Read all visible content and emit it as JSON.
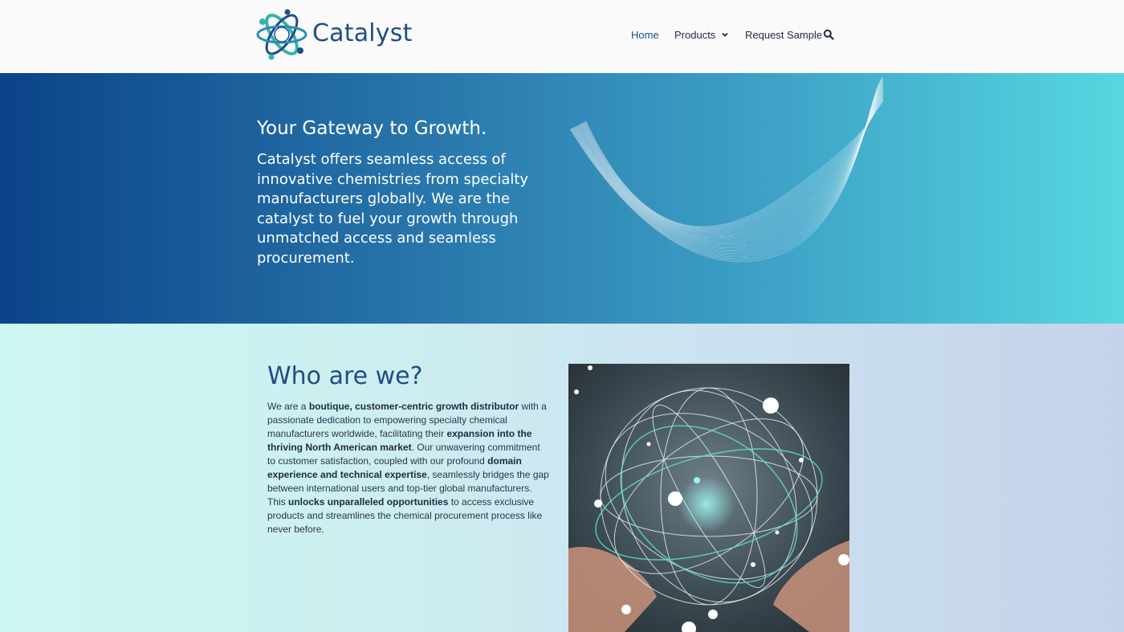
{
  "header": {
    "brand": "Catalyst",
    "nav": {
      "home": "Home",
      "products": "Products",
      "request": "Request Sample"
    }
  },
  "hero": {
    "title": "Your Gateway to Growth.",
    "text": "Catalyst offers seamless access of innovative chemistries from specialty manufacturers globally.  We are the catalyst to fuel your growth through unmatched access and seamless procurement."
  },
  "about": {
    "title": "Who are we?",
    "p1": "We are a ",
    "b1": "boutique, customer-centric growth distributor",
    "p2": " with a passionate dedication to empowering specialty chemical manufacturers worldwide, facilitating their ",
    "b2": "expansion into the thriving North American market",
    "p3": ". Our unwavering commitment to customer satisfaction, coupled with our profound ",
    "b3": "domain experience and technical expertise",
    "p4": ", seamlessly bridges the gap between international users and top-tier global manufacturers. This ",
    "b4": "unlocks unparalleled opportunities",
    "p5": " to access exclusive products and streamlines the chemical procurement process like never before."
  },
  "colors": {
    "brand": "#1e4e86",
    "hero_start": "#0b4388",
    "hero_end": "#56d7e0",
    "accent_teal": "#36b3b0"
  },
  "icons": {
    "logo": "atom-logo-icon",
    "search": "search-icon",
    "chevron": "chevron-down-icon"
  }
}
